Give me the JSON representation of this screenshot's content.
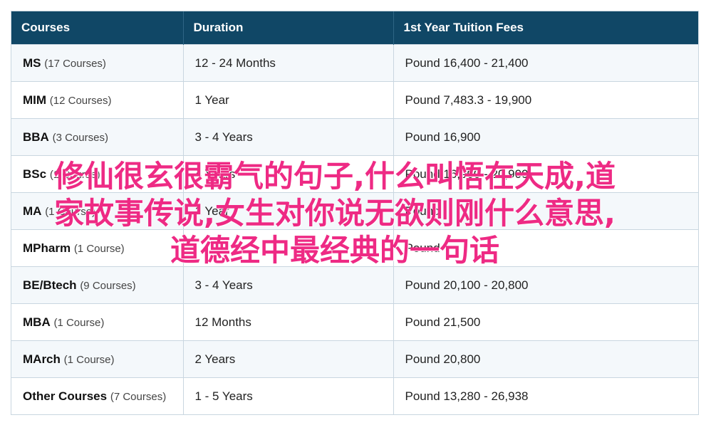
{
  "table": {
    "headers": [
      "Courses",
      "Duration",
      "1st Year Tuition Fees"
    ],
    "rows": [
      {
        "course": "MS",
        "count": "(17 Courses)",
        "duration": "12 - 24 Months",
        "fees": "Pound 16,400 - 21,400"
      },
      {
        "course": "MIM",
        "count": "(12 Courses)",
        "duration": "1 Year",
        "fees": "Pound 7,483.3 - 19,900"
      },
      {
        "course": "BBA",
        "count": "(3 Courses)",
        "duration": "3 - 4 Years",
        "fees": "Pound 16,900"
      },
      {
        "course": "BSc",
        "count": "(1 Course)",
        "duration": "4 Years",
        "fees": "Pound 16,900 - 20,900"
      },
      {
        "course": "MA",
        "count": "(1 Course)",
        "duration": "1 Year",
        "fees": "Pound"
      },
      {
        "course": "MPharm",
        "count": "(1 Course)",
        "duration": "",
        "fees": "Pound"
      },
      {
        "course": "BE/Btech",
        "count": "(9 Courses)",
        "duration": "3 - 4 Years",
        "fees": "Pound 20,100 - 20,800"
      },
      {
        "course": "MBA",
        "count": "(1 Course)",
        "duration": "12 Months",
        "fees": "Pound 21,500"
      },
      {
        "course": "MArch",
        "count": "(1 Course)",
        "duration": "2 Years",
        "fees": "Pound 20,800"
      },
      {
        "course": "Other Courses",
        "count": "(7 Courses)",
        "duration": "1 - 5 Years",
        "fees": "Pound 13,280 - 26,938"
      }
    ]
  },
  "overlay": {
    "line1": "修仙很玄很霸气的句子,什么叫悟在天成,道",
    "line2": "家故事传说,女生对你说无欲则刚什么意思,",
    "line3": "道德经中最经典的一句话"
  },
  "colors": {
    "header_bg": "#104766",
    "overlay_text": "#ee2a84"
  }
}
